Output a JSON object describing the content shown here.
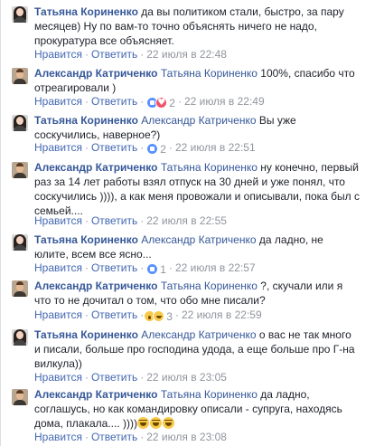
{
  "actions": {
    "like": "Нравится",
    "reply": "Ответить",
    "sep": "·"
  },
  "comments": [
    {
      "author": "Татьяна Кориненко",
      "tag": "",
      "text": "да вы политиком стали, быстро, за пару месяцев) Ну по вам-то точно объяснять ничего не надо, прокуратура все объясняет.",
      "time": "22 июля в 22:48",
      "reaction_count": ""
    },
    {
      "author": "Александр Катриченко",
      "tag": "Татьяна Кориненко",
      "text": "100%, спасибо что отреагировали )",
      "time": "22 июля в 22:49",
      "reaction_count": "2"
    },
    {
      "author": "Татьяна Кориненко",
      "tag": "Александр Катриченко",
      "text": "Вы уже соскучились, наверное?)",
      "time": "22 июля в 22:51",
      "reaction_count": "2"
    },
    {
      "author": "Александр Катриченко",
      "tag": "Татьяна Кориненко",
      "text": "ну конечно, первый раз за 14 лет работы взял отпуск на 30 дней и уже понял, что соскучились )))), а как меня провожали и описывали, пока был с семьей....",
      "time": "22 июля в 22:55",
      "reaction_count": ""
    },
    {
      "author": "Татьяна Кориненко",
      "tag": "Александр Катриченко",
      "text": "да ладно, не юлите, всем все ясно...",
      "time": "22 июля в 22:57",
      "reaction_count": "1"
    },
    {
      "author": "Александр Катриченко",
      "tag": "Татьяна Кориненко",
      "text": "?, скучали или я что то не дочитал о том, что обо мне писали?",
      "time": "22 июля в 22:59",
      "reaction_count": "3"
    },
    {
      "author": "Татьяна Кориненко",
      "tag": "Александр Катриченко",
      "text": "о вас не так много и писали, больше про господина удода, а еще больше про Г-на вилкула))",
      "time": "22 июля в 23:05",
      "reaction_count": ""
    },
    {
      "author": "Александр Катриченко",
      "tag": "Татьяна Кориненко",
      "text": "да ладно, соглашусь, но как командировку описали - супруга, находясь дома, плакала.... ))))",
      "time": "22 июля в 23:08",
      "reaction_count": ""
    }
  ]
}
